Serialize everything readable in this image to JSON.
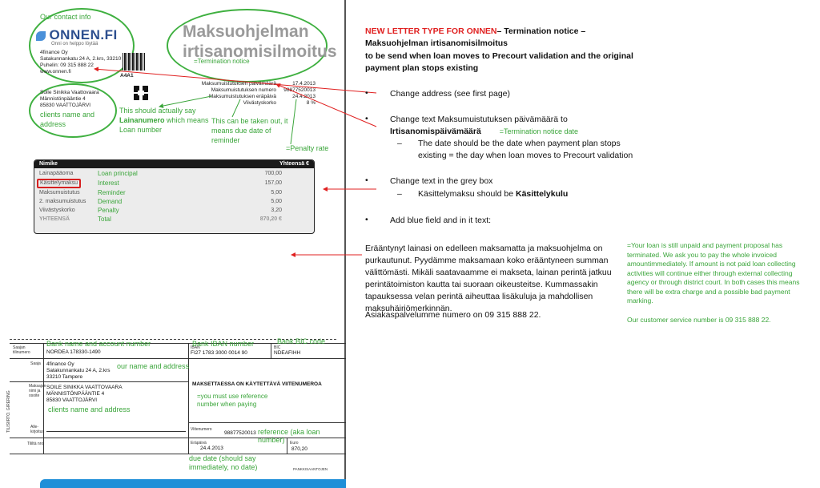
{
  "letter": {
    "contact_note": "Our contact info",
    "logo": "ONNEN.FI",
    "logo_sub": "Onni on helppo löytää",
    "company_lines": [
      "4finance Oy",
      "Satakunnankatu 24 A, 2.krs, 33210 Tampere",
      "Puhelin: 09 315 888 22",
      "www.onnen.fi"
    ],
    "title_lines": [
      "Maksuohjelman",
      "irtisanomisilmoitus"
    ],
    "termination_note": "=Termination notice",
    "barcode_text": "A4A1",
    "customer_lines": [
      "Soile Sinikka Vaattovaara",
      "Männistönpääntie 4",
      "85830 VAATTOJÄRVI"
    ],
    "customer_note": "clients name and address",
    "info_labels": [
      "Maksumuistutuksen päivämäärä",
      "Maksumuistutuksen numero",
      "Maksumuistutuksen eräpäivä",
      "Viivästyskorko"
    ],
    "info_values": [
      "17.4.2013",
      "98877520013",
      "24.4.2013",
      "8 %"
    ],
    "loan_note": [
      "This should actually say",
      "Lainanumero",
      " which",
      "means Loan number"
    ],
    "due_note": "This can be taken out, it means due date of reminder",
    "penalty_note": "=Penalty rate",
    "table": {
      "head_left": "Nimike",
      "head_right": "Yhteensä €",
      "rows": [
        {
          "name": "Lainapääoma",
          "gloss": "Loan principal",
          "value": "700,00"
        },
        {
          "name": "Käsittelymaksu",
          "gloss": "Interest",
          "value": "157,00"
        },
        {
          "name": "Maksumuistutus",
          "gloss": "Reminder",
          "value": "5,00"
        },
        {
          "name": "2. maksumuistutus",
          "gloss": "Demand",
          "value": "5,00"
        },
        {
          "name": "Viivästyskorko",
          "gloss": "Penalty",
          "value": "3,20"
        },
        {
          "name": "YHTEENSÄ",
          "gloss": "Total",
          "value": "870,20 €"
        }
      ]
    },
    "giro": {
      "bank_note": "Bank name and account number",
      "iban_note": "Bank IBAN number",
      "bic_note": "Bank BIC code",
      "lbl_saajan": "Saajan tilinumero",
      "bank_account": "NORDEA 178330-1490",
      "lbl_iban": "IBAN",
      "iban": "FI27 1783 3000 0014 90",
      "lbl_bic": "BIC",
      "bic": "NDEAFIHH",
      "lbl_saaja": "Saaja",
      "payee_lines": [
        "4finance Oy",
        "Satakunnankatu 24 A, 2.krs",
        "33210 Tampere"
      ],
      "payee_note": "our name and address",
      "lbl_maksaja": "Maksajan nimi ja osoite",
      "payer_lines": [
        "SOILE SINIKKA VAATTOVAARA",
        "MÄNNISTÖNPÄÄNTIE 4",
        "85830 VAATTOJÄRVI"
      ],
      "payer_note": "clients name and address",
      "instruction": "MAKSETTAESSA ON KÄYTETTÄVÄ VIITENUMEROA",
      "instruction_note": "=you must use reference number when paying",
      "side_label": "TILISIIRTO. GIRERING",
      "lbl_allekirjoitus": "Alle-kirjoitus",
      "lbl_tililta": "Tililtä nro",
      "lbl_viite": "Viitenumero",
      "reference": "98877520013",
      "reference_note": "reference (aka loan number)",
      "lbl_erapaiva": "Eräpäivä",
      "due_date": "24.4.2013",
      "lbl_euro": "Euro",
      "amount": "870,20",
      "due_note": "due date (should say immediately, no date)",
      "footer": "PANKKISAANTOJEN"
    }
  },
  "notes": {
    "header_red": "NEW LETTER TYPE FOR ONNEN",
    "header_rest": "– Termination notice – Maksuohjelman irtisanomisilmoitus",
    "subheader": "to be send when loan moves to Precourt validation and the original payment plan stops existing",
    "b1": "Change address (see first page)",
    "b2_text": "Change text Maksumuistutuksen päivämäärä to",
    "b2_bold": "Irtisanomispäivämäärä",
    "b2_green": "=Termination notice date",
    "b2_sub": "The date should be the date when payment plan stops existing = the day when loan moves to Precourt validation",
    "b3": "Change text in the grey box",
    "b3_sub_text": "Käsittelymaksu should be ",
    "b3_sub_bold": "Käsittelykulu",
    "b4": "Add blue field and in it text:",
    "finnish_para": "Erääntynyt lainasi on edelleen maksamatta ja maksuohjelma on purkautunut. Pyydämme maksamaan koko erääntyneen summan välittömästi. Mikäli saatavaamme ei makseta, lainan perintä jatkuu perintätoimiston kautta tai suoraan oikeusteitse. Kummassakin tapauksessa velan perintä aiheuttaa lisäkuluja ja mahdollisen maksuhäiriömerkinnän.",
    "finnish_phone": "Asiakaspalvelumme numero on 09 315 888 22.",
    "english_para": "=Your loan is still unpaid and payment proposal has terminated. We ask you to pay the whole invoiced amountimmediately. If amount is not paid loan collecting activities will continue either through external collecting agency or through district court. In both cases this means there will be extra charge and a possible bad payment marking.",
    "english_phone": "Our customer service number is 09 315 888 22."
  },
  "colors": {
    "red": "#e02020",
    "green": "#3aa53a",
    "logo_blue": "#2d4f8f",
    "blue_bar": "#1f8fd8"
  }
}
